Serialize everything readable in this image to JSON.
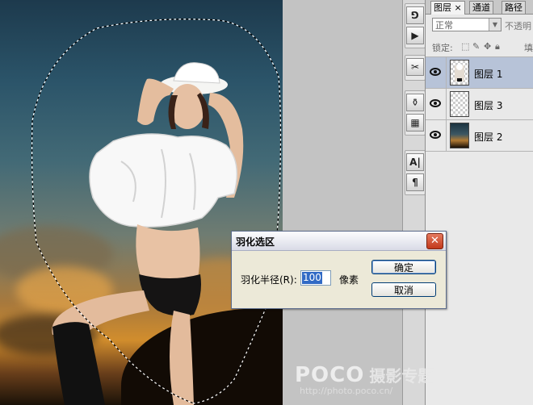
{
  "panel": {
    "tabs": [
      {
        "label": "图层",
        "active": true,
        "close": "×"
      },
      {
        "label": "通道",
        "active": false
      },
      {
        "label": "路径",
        "active": false
      }
    ],
    "blend_mode": "正常",
    "opacity_label": "不透明",
    "lock_label": "锁定:",
    "fill_label": "填",
    "layers": [
      {
        "name": "图层 1",
        "selected": true
      },
      {
        "name": "图层 3",
        "selected": false
      },
      {
        "name": "图层 2",
        "selected": false
      }
    ]
  },
  "tools": [
    "history-icon",
    "play-icon",
    "brush-options-icon",
    "clone-source-icon",
    "tool-presets-icon",
    "character-icon",
    "paragraph-icon"
  ],
  "tool_glyphs": [
    "⅁",
    "▶",
    "✂",
    "⚱",
    "▦",
    "A|",
    "¶"
  ],
  "dialog": {
    "title": "羽化选区",
    "close": "✕",
    "radius_label": "羽化半径(R):",
    "radius_value": "100",
    "unit": "像素",
    "ok": "确定",
    "cancel": "取消"
  },
  "watermark": {
    "logo": "POCO",
    "text": "摄影专题",
    "url": "http://photo.poco.cn/"
  }
}
